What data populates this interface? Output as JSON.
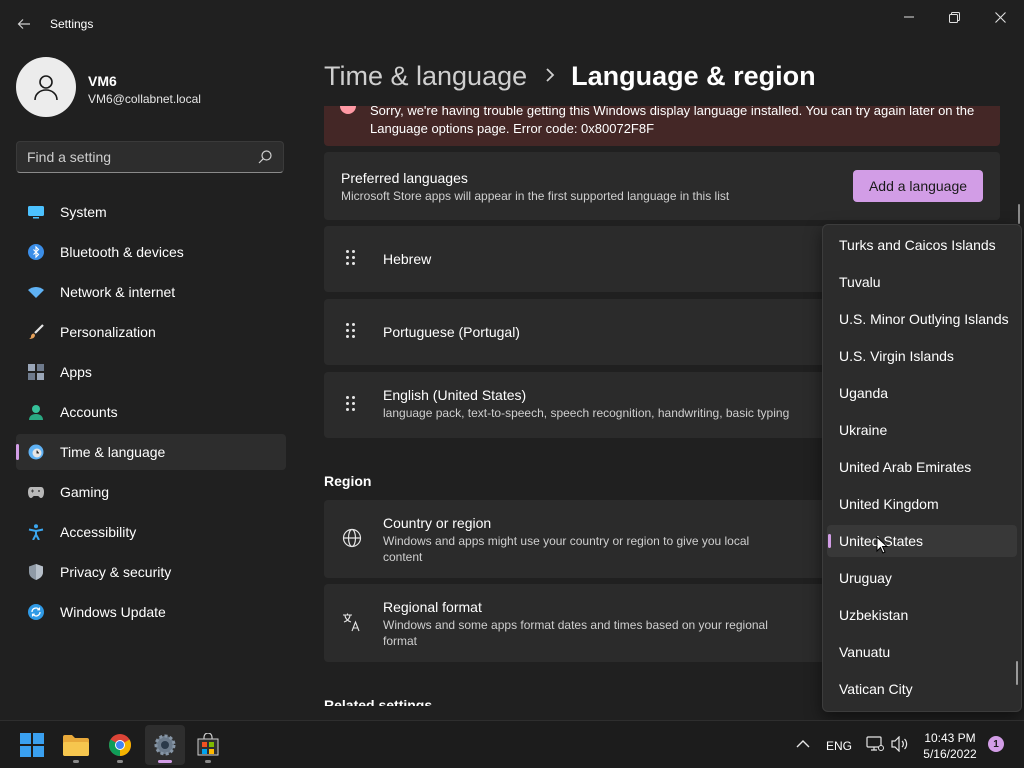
{
  "app": {
    "title": "Settings"
  },
  "window_controls": {
    "minimize": "minimize-icon",
    "maximize": "restore-icon",
    "close": "close-icon"
  },
  "profile": {
    "name": "VM6",
    "email": "VM6@collabnet.local"
  },
  "search": {
    "placeholder": "Find a setting"
  },
  "sidebar": {
    "items": [
      {
        "label": "System",
        "icon": "system-icon",
        "color": "#4cc2ff"
      },
      {
        "label": "Bluetooth & devices",
        "icon": "bluetooth-icon",
        "color": "#3b8ee8"
      },
      {
        "label": "Network & internet",
        "icon": "wifi-icon",
        "color": "#5fb2f5"
      },
      {
        "label": "Personalization",
        "icon": "brush-icon",
        "color": "#e6a15a"
      },
      {
        "label": "Apps",
        "icon": "apps-icon",
        "color": "#9aa6b8"
      },
      {
        "label": "Accounts",
        "icon": "accounts-icon",
        "color": "#36c19a"
      },
      {
        "label": "Time & language",
        "icon": "clock-globe-icon",
        "color": "#5fb2f5",
        "active": true
      },
      {
        "label": "Gaming",
        "icon": "gamepad-icon",
        "color": "#b8b8b8"
      },
      {
        "label": "Accessibility",
        "icon": "accessibility-icon",
        "color": "#3ba7f0"
      },
      {
        "label": "Privacy & security",
        "icon": "shield-icon",
        "color": "#8f9aa6"
      },
      {
        "label": "Windows Update",
        "icon": "update-icon",
        "color": "#2f9ae6"
      }
    ]
  },
  "breadcrumb": {
    "parent": "Time & language",
    "current": "Language & region"
  },
  "error": {
    "text": "Sorry, we're having trouble getting this Windows display language installed. You can try again later on the Language options page. Error code: 0x80072F8F"
  },
  "preferred_languages": {
    "title": "Preferred languages",
    "subtitle": "Microsoft Store apps will appear in the first supported language in this list",
    "add_button": "Add a language",
    "languages": [
      {
        "name": "Hebrew",
        "detail": ""
      },
      {
        "name": "Portuguese (Portugal)",
        "detail": ""
      },
      {
        "name": "English (United States)",
        "detail": "language pack, text-to-speech, speech recognition, handwriting, basic typing"
      }
    ]
  },
  "region": {
    "heading": "Region",
    "country": {
      "title": "Country or region",
      "subtitle": "Windows and apps might use your country or region to give you local content"
    },
    "format": {
      "title": "Regional format",
      "subtitle": "Windows and some apps format dates and times based on your regional format"
    }
  },
  "related_settings": {
    "heading": "Related settings"
  },
  "country_dropdown": {
    "options": [
      "Turks and Caicos Islands",
      "Tuvalu",
      "U.S. Minor Outlying Islands",
      "U.S. Virgin Islands",
      "Uganda",
      "Ukraine",
      "United Arab Emirates",
      "United Kingdom",
      "United States",
      "Uruguay",
      "Uzbekistan",
      "Vanuatu",
      "Vatican City"
    ],
    "selected": "United States"
  },
  "taskbar": {
    "apps": [
      "start-icon",
      "file-explorer-icon",
      "chrome-icon",
      "settings-app-icon",
      "store-icon"
    ],
    "language": "ENG",
    "time": "10:43 PM",
    "date": "5/16/2022",
    "notifications": "1"
  },
  "colors": {
    "accent": "#d29de6",
    "error_bg": "#442726",
    "card_bg": "#2b2b2b",
    "window_bg": "#202020"
  }
}
